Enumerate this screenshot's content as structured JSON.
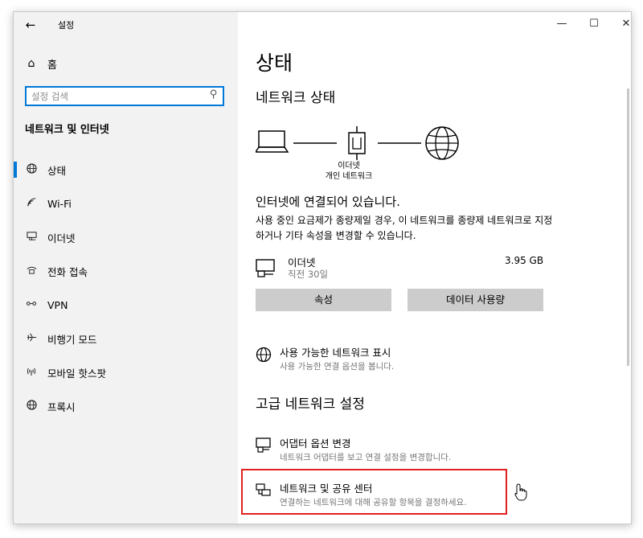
{
  "window": {
    "title": "설정",
    "back_icon": "←",
    "controls": {
      "minimize": "—",
      "maximize": "☐",
      "close": "✕"
    }
  },
  "sidebar": {
    "home_label": "홈",
    "search_placeholder": "설정 검색",
    "section_title": "네트워크 및 인터넷",
    "items": [
      {
        "label": "상태",
        "icon": "globe-icon",
        "active": true
      },
      {
        "label": "Wi-Fi",
        "icon": "wifi-icon",
        "active": false
      },
      {
        "label": "이더넷",
        "icon": "ethernet-icon",
        "active": false
      },
      {
        "label": "전화 접속",
        "icon": "dialup-icon",
        "active": false
      },
      {
        "label": "VPN",
        "icon": "vpn-icon",
        "active": false
      },
      {
        "label": "비행기 모드",
        "icon": "airplane-icon",
        "active": false
      },
      {
        "label": "모바일 핫스팟",
        "icon": "hotspot-icon",
        "active": false
      },
      {
        "label": "프록시",
        "icon": "proxy-globe-icon",
        "active": false
      }
    ]
  },
  "main": {
    "page_title": "상태",
    "network_status_heading": "네트워크 상태",
    "diagram_caption_line1": "이더넷",
    "diagram_caption_line2": "개인 네트워크",
    "connected_title": "인터넷에 연결되어 있습니다.",
    "connected_desc": "사용 중인 요금제가 종량제일 경우, 이 네트워크를 종량제 네트워크로 지정하거나 기타 속성을 변경할 수 있습니다.",
    "ethernet": {
      "name": "이더넷",
      "sub": "직전 30일",
      "size": "3.95 GB"
    },
    "buttons": {
      "properties": "속성",
      "data_usage": "데이터 사용량"
    },
    "show_networks": {
      "title": "사용 가능한 네트워크 표시",
      "desc": "사용 가능한 연결 옵션을 봅니다."
    },
    "advanced_heading": "고급 네트워크 설정",
    "adapter_options": {
      "title": "어댑터 옵션 변경",
      "desc": "네트워크 어댑터를 보고 연결 설정을 변경합니다."
    },
    "sharing_center": {
      "title": "네트워크 및 공유 센터",
      "desc": "연결하는 네트워크에 대해 공유할 항목을 결정하세요."
    }
  },
  "colors": {
    "accent": "#0078d7",
    "highlight_border": "#e02020",
    "sidebar_bg": "#f2f2f2",
    "button_bg": "#cccccc"
  }
}
